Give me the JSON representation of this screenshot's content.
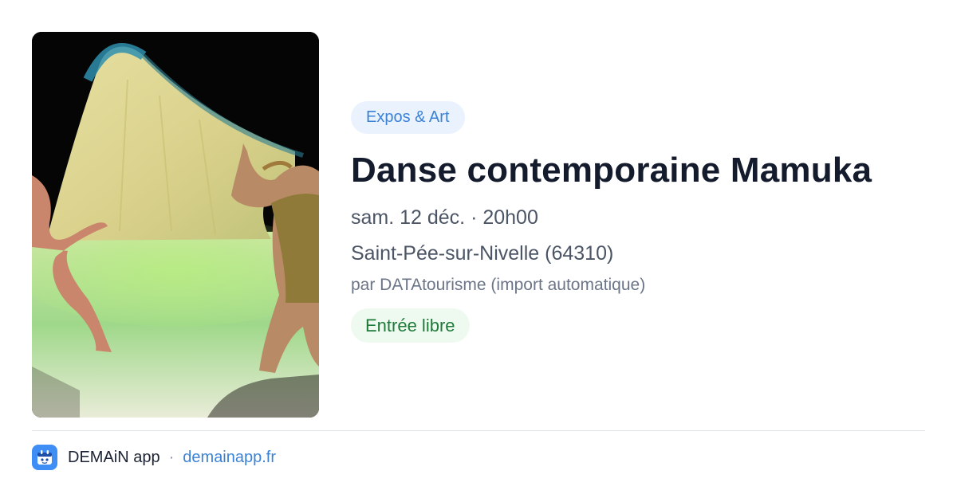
{
  "event": {
    "image": {
      "description_icon": "event-photo",
      "alt": "Danse contemporaine Mamuka"
    },
    "category": "Expos & Art",
    "title": "Danse contemporaine Mamuka",
    "datetime": "sam. 12 déc. · 20h00",
    "location": "Saint-Pée-sur-Nivelle (64310)",
    "organizer": "par DATAtourisme (import automatique)",
    "price": "Entrée libre"
  },
  "footer": {
    "app_name": "DEMAiN app",
    "separator": "·",
    "url": "demainapp.fr"
  },
  "colors": {
    "accent": "#3b82d6",
    "category_bg": "#eaf2fd",
    "price_text": "#1f7a3a",
    "price_bg": "#eefaf0",
    "title": "#141b2d"
  }
}
